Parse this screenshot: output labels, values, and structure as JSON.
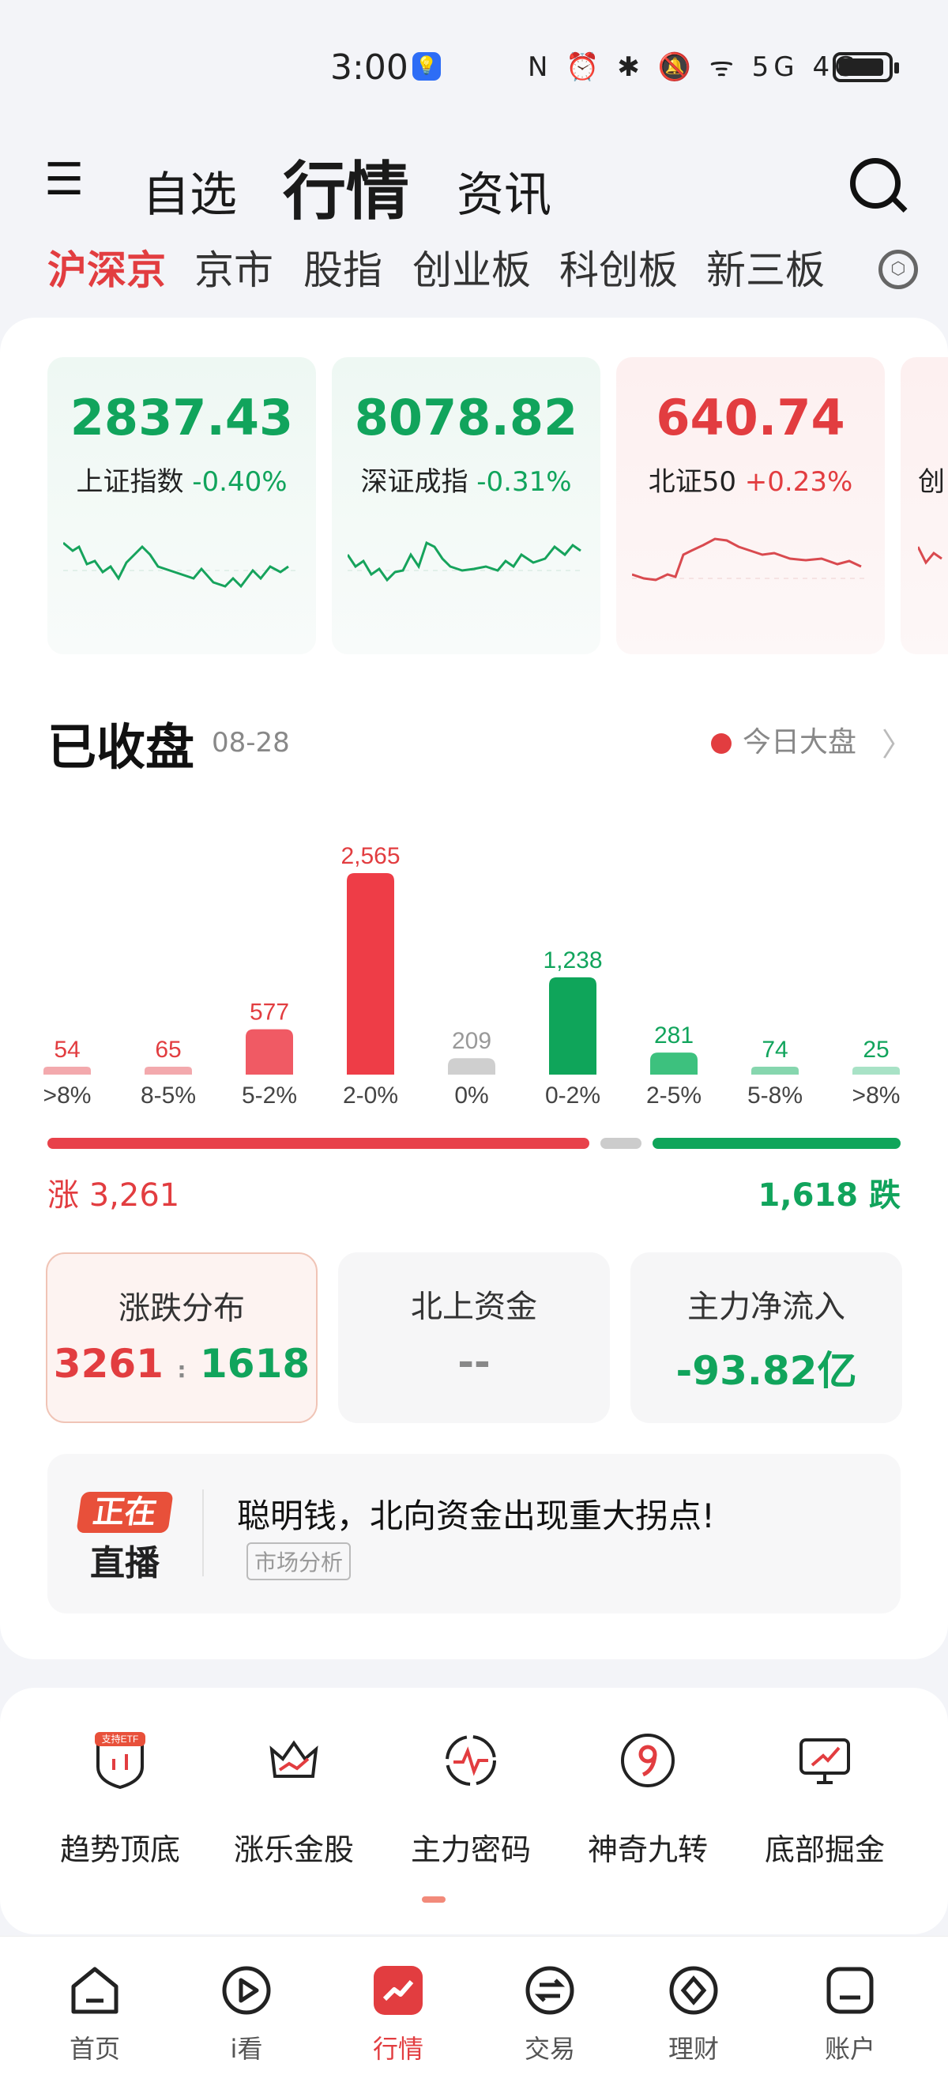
{
  "status_bar": {
    "time": "3:00",
    "icons": "N ⏰ ✱ 🔕 ᯤ 5G 4G"
  },
  "header": {
    "tabs": [
      "自选",
      "行情",
      "资讯"
    ],
    "active_tab": "行情"
  },
  "market_tabs": [
    "沪深京",
    "京市",
    "股指",
    "创业板",
    "科创板",
    "新三板"
  ],
  "indices": [
    {
      "value": "2837.43",
      "name": "上证指数",
      "change": "-0.40%",
      "trend": "down"
    },
    {
      "value": "8078.82",
      "name": "深证成指",
      "change": "-0.31%",
      "trend": "down"
    },
    {
      "value": "640.74",
      "name": "北证50",
      "change": "+0.23%",
      "trend": "up"
    },
    {
      "value": "",
      "name": "创",
      "change": "",
      "trend": "up"
    }
  ],
  "section": {
    "title": "已收盘",
    "date": "08-28",
    "link": "今日大盘"
  },
  "chart_data": {
    "type": "bar",
    "categories": [
      ">8%",
      "8-5%",
      "5-2%",
      "2-0%",
      "0%",
      "0-2%",
      "2-5%",
      "5-8%",
      ">8%"
    ],
    "values": [
      54,
      65,
      577,
      2565,
      209,
      1238,
      281,
      74,
      25
    ],
    "value_labels": [
      "54",
      "65",
      "577",
      "2,565",
      "209",
      "1,238",
      "281",
      "74",
      "25"
    ],
    "colors": [
      "#f3a9ad",
      "#f3a9ad",
      "#f05a64",
      "#ee3d47",
      "#cfcfcf",
      "#0fa55a",
      "#3dc17e",
      "#86d6ae",
      "#a8e2c6"
    ],
    "label_colors": [
      "#e23d40",
      "#e23d40",
      "#e23d40",
      "#e23d40",
      "#999999",
      "#11a45c",
      "#11a45c",
      "#11a45c",
      "#11a45c"
    ]
  },
  "summary": {
    "up_label": "涨 3,261",
    "down_label": "1,618 跌"
  },
  "stats": [
    {
      "title": "涨跌分布",
      "up": "3261",
      "sep": ":",
      "down": "1618"
    },
    {
      "title": "北上资金",
      "value": "--"
    },
    {
      "title": "主力净流入",
      "value": "-93.82亿"
    }
  ],
  "live": {
    "badge_top": "正在",
    "badge_bottom": "直播",
    "title": "聪明钱，北向资金出现重大拐点!",
    "tag": "市场分析"
  },
  "tools": [
    {
      "label": "趋势顶底",
      "badge": "支持ETF"
    },
    {
      "label": "涨乐金股"
    },
    {
      "label": "主力密码"
    },
    {
      "label": "神奇九转"
    },
    {
      "label": "底部掘金"
    }
  ],
  "nav": [
    "首页",
    "i看",
    "行情",
    "交易",
    "理财",
    "账户"
  ],
  "nav_active": "行情"
}
